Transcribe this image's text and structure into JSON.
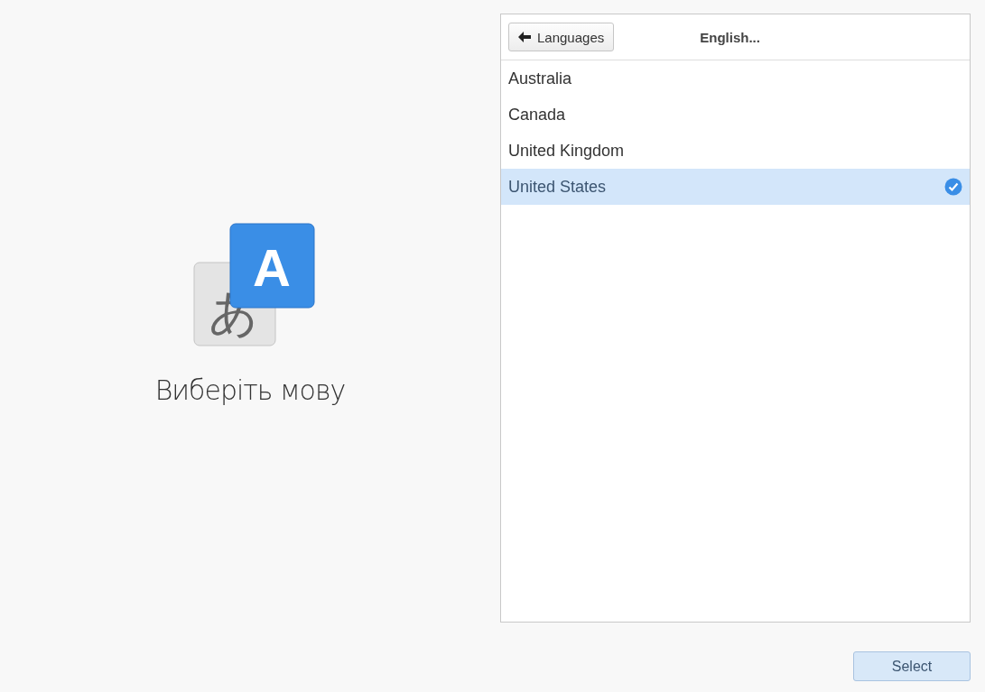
{
  "language_icon": {
    "back_glyph": "あ",
    "front_glyph": "A"
  },
  "title": "Виберіть мову",
  "header": {
    "back_button": "Languages",
    "current_language": "English..."
  },
  "regions": [
    {
      "label": "Australia",
      "selected": false
    },
    {
      "label": "Canada",
      "selected": false
    },
    {
      "label": "United Kingdom",
      "selected": false
    },
    {
      "label": "United States",
      "selected": true
    }
  ],
  "buttons": [
    "Select"
  ]
}
